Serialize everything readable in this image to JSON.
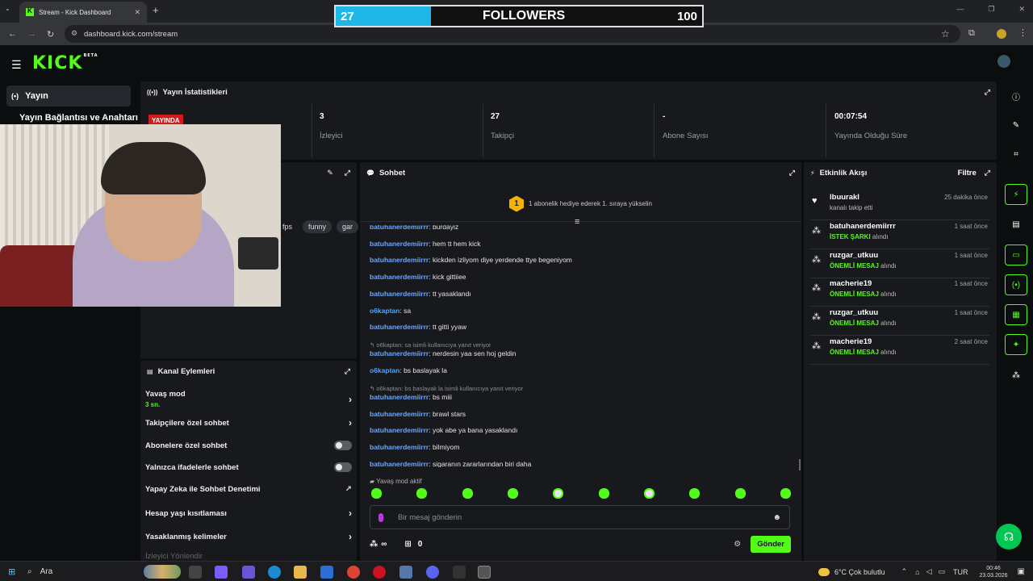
{
  "browser": {
    "tab_title": "Stream - Kick Dashboard",
    "url": "dashboard.kick.com/stream"
  },
  "overlay": {
    "current": "27",
    "label": "FOLLOWERS",
    "goal": "100",
    "progress_fraction": 0.27,
    "color": "#1fb6e8"
  },
  "brand": {
    "logo": "KICK",
    "logo_tag": "BETA",
    "accent": "#53fc18"
  },
  "sidebar": {
    "active_label": "Yayın",
    "sub_label": "Yayın Bağlantısı ve Anahtarı"
  },
  "stats": {
    "title": "Yayın İstatistikleri",
    "live_badge": "YAYINDA",
    "items": [
      {
        "value": "3",
        "label": "İzleyici"
      },
      {
        "value": "27",
        "label": "Takipçi"
      },
      {
        "value": "-",
        "label": "Abone Sayısı"
      },
      {
        "value": "00:07:54",
        "label": "Yayında Olduğu Süre"
      }
    ]
  },
  "preview": {
    "tags": [
      "fps",
      "funny",
      "gar"
    ]
  },
  "channel_actions": {
    "title": "Kanal Eylemleri",
    "slow_mode": "Yavaş mod",
    "slow_mode_value": "3 sn.",
    "followers_only": "Takipçilere özel sohbet",
    "subs_only": "Abonelere özel sohbet",
    "emotes_only": "Yalnızca ifadelerle sohbet",
    "ai_moderation": "Yapay Zeka ile Sohbet Denetimi",
    "account_age": "Hesap yaşı kısıtlaması",
    "banned_words": "Yasaklanmış kelimeler",
    "cut_off": "İzleyici Yönlendir"
  },
  "chat": {
    "title": "Sohbet",
    "banner_rank": "1",
    "banner_text": "1 abonelik hediye ederek 1. sıraya yükselin",
    "messages": [
      {
        "user": "batuhanerdemiirrr",
        "text": "burdayiz"
      },
      {
        "user": "batuhanerdemiirrr",
        "text": "hem tt hem kick"
      },
      {
        "user": "batuhanerdemiirrr",
        "text": "kickden izliyom diye yerdende ttye begeniyom"
      },
      {
        "user": "batuhanerdemiirrr",
        "text": "kick gittiiee"
      },
      {
        "user": "batuhanerdemiirrr",
        "text": "tt yasaklandı"
      },
      {
        "user": "o6kaptan",
        "text": "sa"
      },
      {
        "user": "batuhanerdemiirrr",
        "text": "tt gitti yyaw"
      },
      {
        "reply": "o6kaptan: sa isimli kullanıcıya yanıt veriyor",
        "user": "batuhanerdemiirrr",
        "text": "nerdesin yaa sen hoj geldin"
      },
      {
        "user": "o6kaptan",
        "text": "bs baslayak la"
      },
      {
        "reply": "o6kaptan: bs baslayak la isimli kullanıcıya yanıt veriyor",
        "user": "batuhanerdemiirrr",
        "text": "bs miii"
      },
      {
        "user": "batuhanerdemiirrr",
        "text": "brawl stars"
      },
      {
        "user": "batuhanerdemiirrr",
        "text": "yok abe ya bana yasaklandı"
      },
      {
        "user": "batuhanerdemiirrr",
        "text": "bilmiyom"
      },
      {
        "user": "batuhanerdemiirrr",
        "text": "sigaranın zararlarından biri daha"
      }
    ],
    "slow_mode_notice": "Yavaş mod aktif",
    "input_placeholder": "Bir mesaj gönderin",
    "points": "∞",
    "count": "0",
    "send_label": "Gönder"
  },
  "activity": {
    "title": "Etkinlik Akışı",
    "filter_label": "Filtre",
    "items": [
      {
        "name": "lbuurakl",
        "time": "25 dakika önce",
        "desc_hl": "",
        "desc": "kanalı takip etti"
      },
      {
        "name": "batuhanerdemiirrr",
        "time": "1 saat önce",
        "desc_hl": "İSTEK ŞARKI",
        "desc": "alındı"
      },
      {
        "name": "ruzgar_utkuu",
        "time": "1 saat önce",
        "desc_hl": "ÖNEMLİ MESAJ",
        "desc": "alındı"
      },
      {
        "name": "macherie19",
        "time": "1 saat önce",
        "desc_hl": "ÖNEMLİ MESAJ",
        "desc": "alındı"
      },
      {
        "name": "ruzgar_utkuu",
        "time": "1 saat önce",
        "desc_hl": "ÖNEMLİ MESAJ",
        "desc": "alındı"
      },
      {
        "name": "macherie19",
        "time": "2 saat önce",
        "desc_hl": "ÖNEMLİ MESAJ",
        "desc": "alındı"
      }
    ]
  },
  "taskbar": {
    "search_label": "Ara",
    "weather": "6°C  Çok bulutlu",
    "lang": "TUR",
    "time": "00:46",
    "date": "23.03.2026"
  }
}
